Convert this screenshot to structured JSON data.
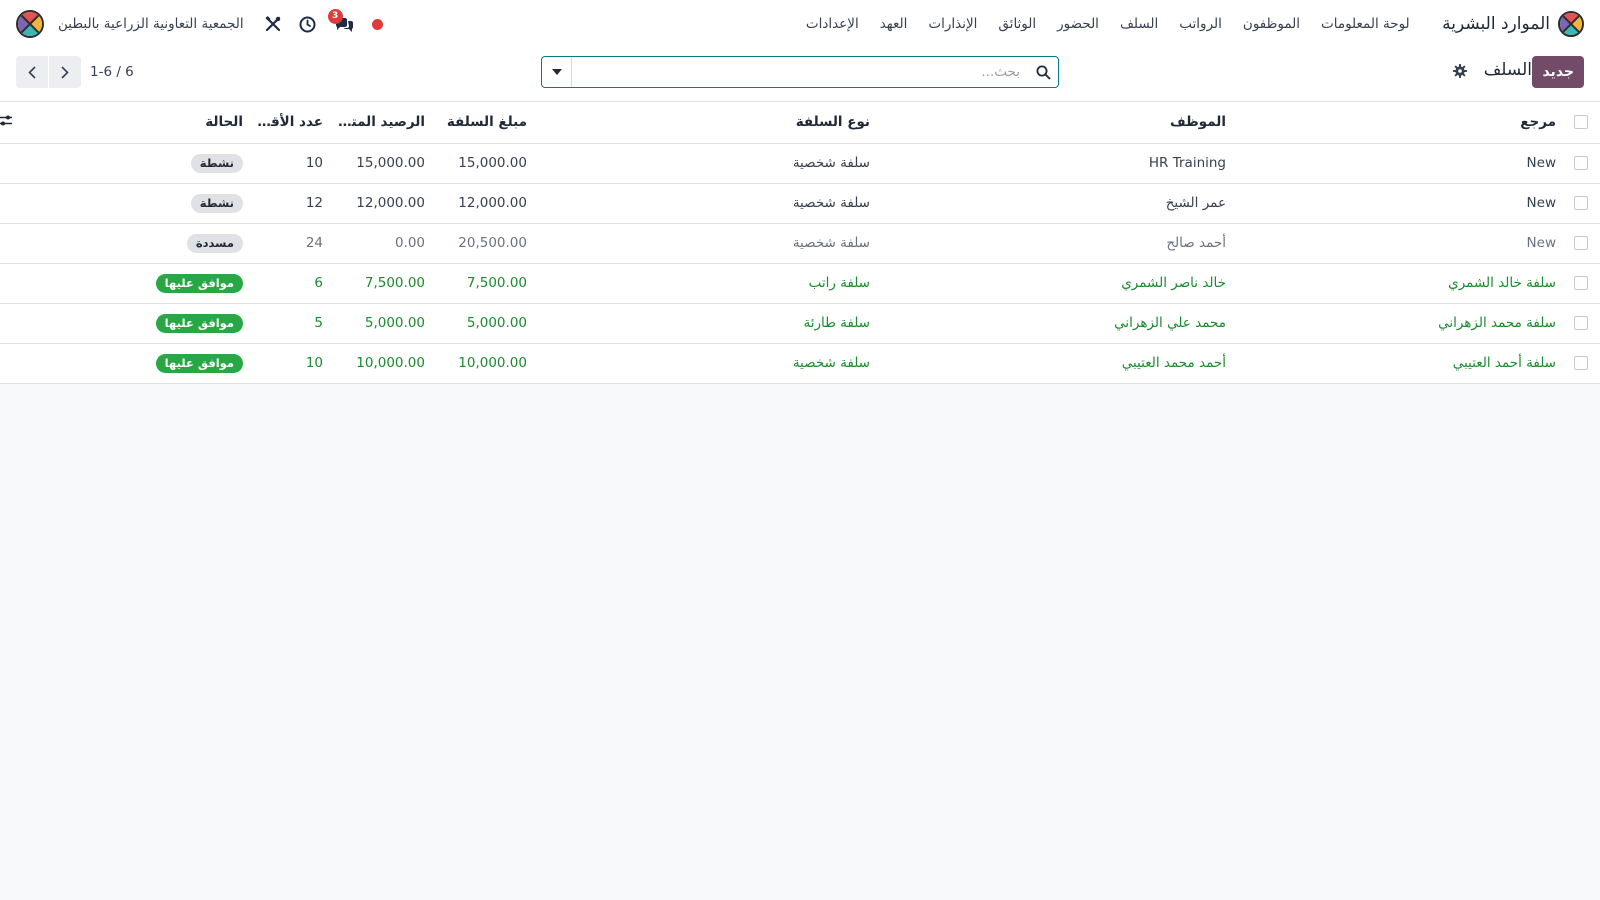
{
  "colors": {
    "brand": "#714b67",
    "accent": "#017e84",
    "approved": "#27a844",
    "notification": "#e03a3a"
  },
  "navbar": {
    "app_name": "الموارد البشرية",
    "menu": [
      {
        "label": "لوحة المعلومات"
      },
      {
        "label": "الموظفون"
      },
      {
        "label": "الرواتب"
      },
      {
        "label": "السلف"
      },
      {
        "label": "الحضور"
      },
      {
        "label": "الوثائق"
      },
      {
        "label": "الإنذارات"
      },
      {
        "label": "العهد"
      },
      {
        "label": "الإعدادات"
      }
    ],
    "systray": {
      "messages_count": "3",
      "company_name": "الجمعية التعاونية الزراعية بالبطين",
      "icons": [
        "status-dot-icon",
        "chat-icon",
        "clock-icon",
        "tools-icon"
      ]
    }
  },
  "control_panel": {
    "new_button": "جديد",
    "title": "السلف",
    "search_placeholder": "بحث...",
    "search_value": "",
    "pager": "1-6 / 6"
  },
  "table": {
    "headers": {
      "reference": "مرجع",
      "employee": "الموظف",
      "advance_type": "نوع السلفة",
      "amount": "مبلغ السلفة",
      "remaining": "الرصيد المتبقي",
      "installments": "عدد الأقساط",
      "state": "الحالة"
    },
    "rows": [
      {
        "reference": "New",
        "employee": "HR Training",
        "advance_type": "سلفة شخصية",
        "amount": "15,000.00",
        "remaining": "15,000.00",
        "installments": "10",
        "state": "نشطة",
        "state_kind": "grey",
        "row_kind": "active"
      },
      {
        "reference": "New",
        "employee": "عمر الشيخ",
        "advance_type": "سلفة شخصية",
        "amount": "12,000.00",
        "remaining": "12,000.00",
        "installments": "12",
        "state": "نشطة",
        "state_kind": "grey",
        "row_kind": "active"
      },
      {
        "reference": "New",
        "employee": "أحمد صالح",
        "advance_type": "سلفة شخصية",
        "amount": "20,500.00",
        "remaining": "0.00",
        "installments": "24",
        "state": "مسددة",
        "state_kind": "grey",
        "row_kind": "paid"
      },
      {
        "reference": "سلفة خالد الشمري",
        "employee": "خالد ناصر الشمري",
        "advance_type": "سلفة راتب",
        "amount": "7,500.00",
        "remaining": "7,500.00",
        "installments": "6",
        "state": "موافق عليها",
        "state_kind": "green",
        "row_kind": "approved"
      },
      {
        "reference": "سلفة محمد الزهراني",
        "employee": "محمد علي الزهراني",
        "advance_type": "سلفة طارئة",
        "amount": "5,000.00",
        "remaining": "5,000.00",
        "installments": "5",
        "state": "موافق عليها",
        "state_kind": "green",
        "row_kind": "approved"
      },
      {
        "reference": "سلفة أحمد العتيبي",
        "employee": "أحمد محمد العتيبي",
        "advance_type": "سلفة شخصية",
        "amount": "10,000.00",
        "remaining": "10,000.00",
        "installments": "10",
        "state": "موافق عليها",
        "state_kind": "green",
        "row_kind": "approved"
      }
    ]
  }
}
